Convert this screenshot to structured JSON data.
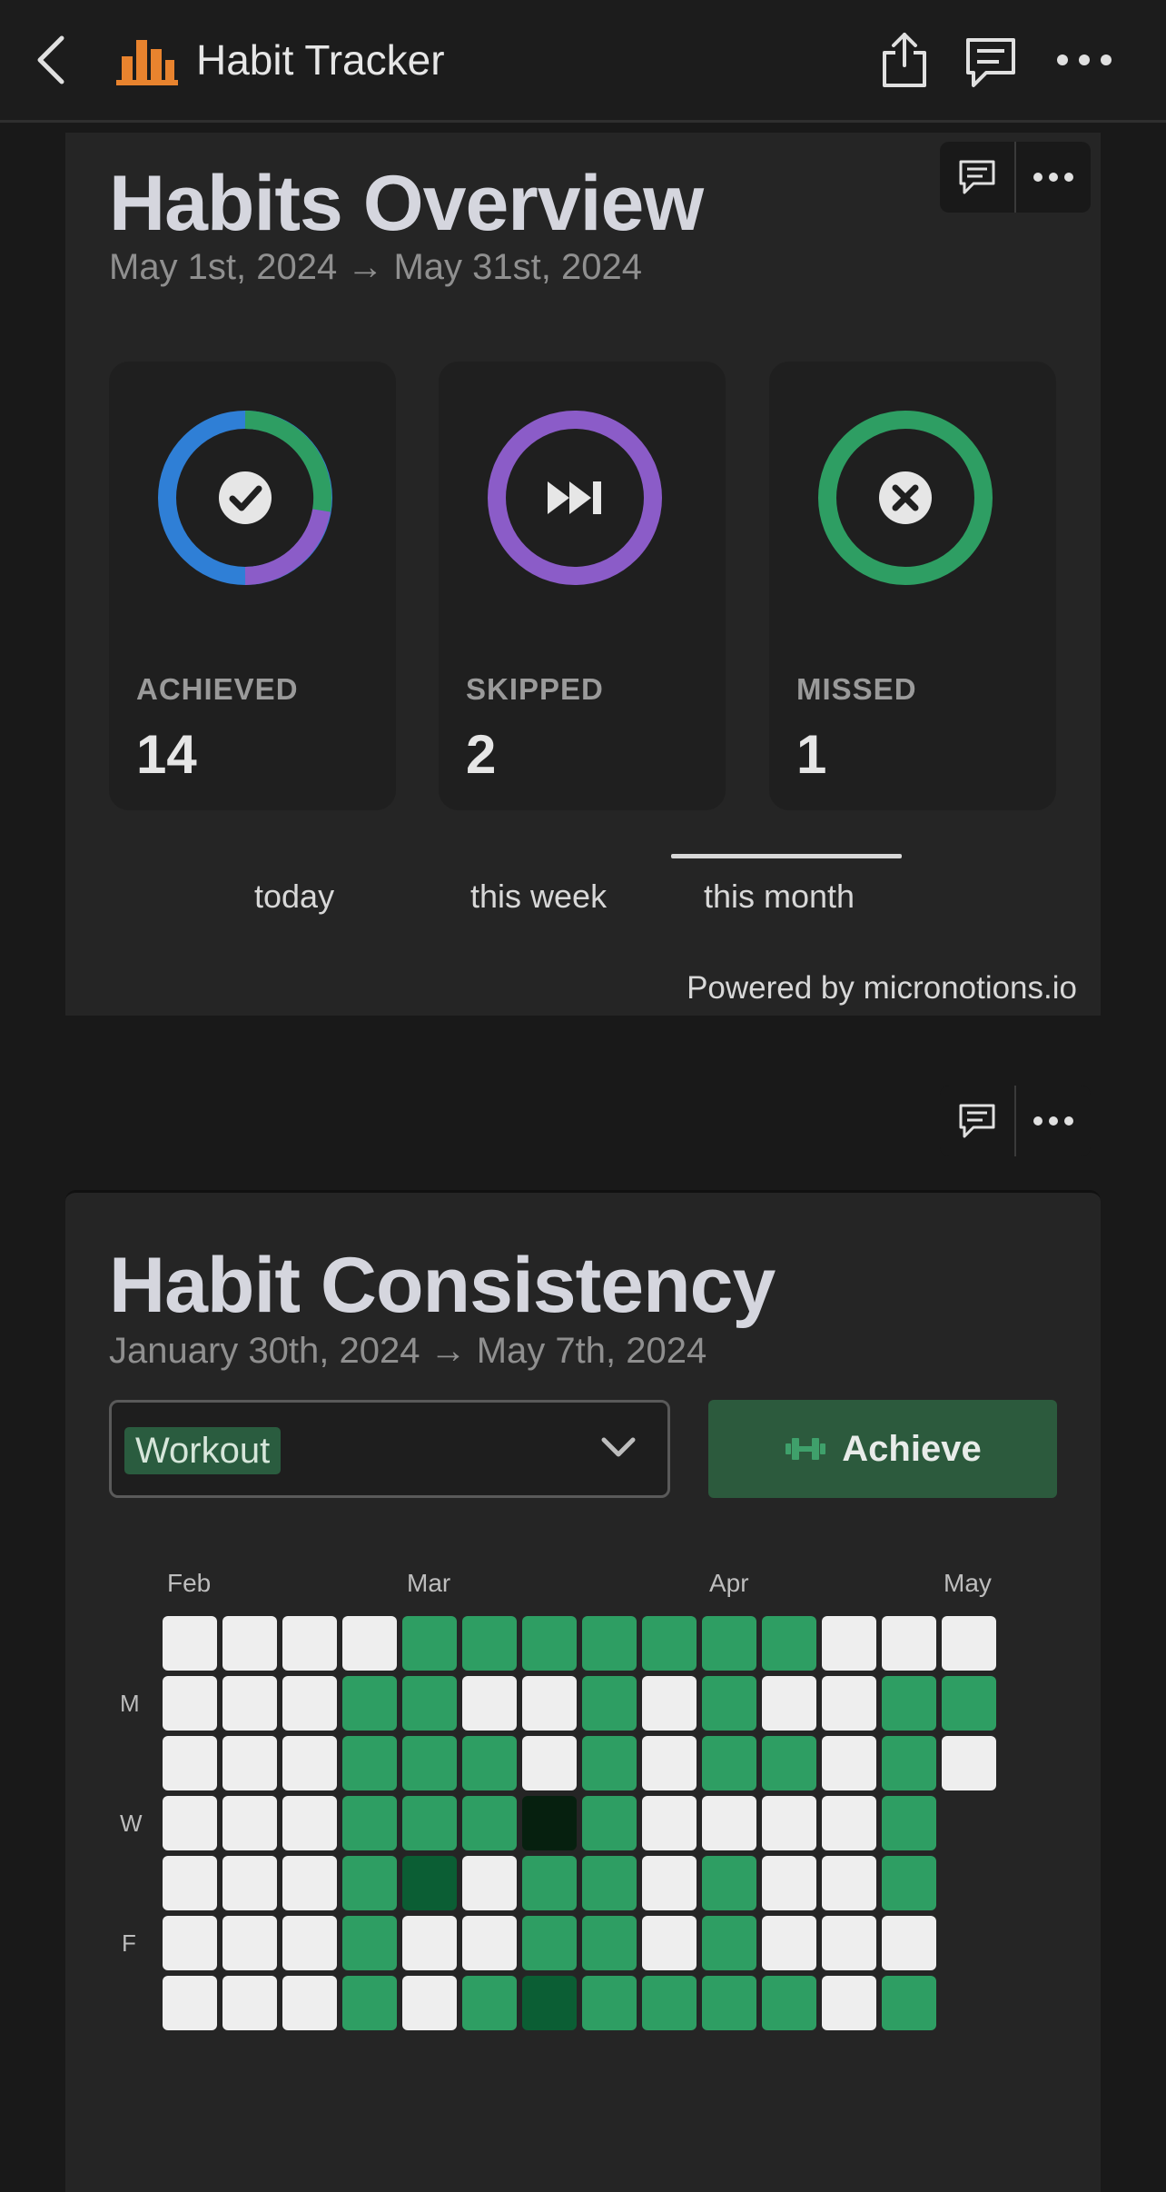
{
  "topbar": {
    "title": "Habit Tracker"
  },
  "overview": {
    "title": "Habits Overview",
    "date_range": "May 1st, 2024 → May 31st, 2024",
    "stats": [
      {
        "label": "ACHIEVED",
        "value": "14",
        "icon": "check-icon"
      },
      {
        "label": "SKIPPED",
        "value": "2",
        "icon": "skip-forward-icon"
      },
      {
        "label": "MISSED",
        "value": "1",
        "icon": "x-circle-icon"
      }
    ],
    "tabs": [
      "today",
      "this week",
      "this month"
    ],
    "active_tab": "this month",
    "powered_by": "Powered by micronotions.io"
  },
  "consistency": {
    "title": "Habit Consistency",
    "date_range": "January 30th, 2024 → May 7th, 2024",
    "habit_select": "Workout",
    "achieve_label": "Achieve",
    "months": [
      "Feb",
      "Mar",
      "Apr",
      "May"
    ],
    "day_labels": [
      "M",
      "W",
      "F"
    ],
    "heatmap": [
      [
        0,
        0,
        0,
        0,
        1,
        1,
        1,
        1,
        1,
        1,
        1,
        0,
        0,
        0
      ],
      [
        0,
        0,
        0,
        1,
        1,
        0,
        0,
        1,
        0,
        1,
        0,
        0,
        1,
        1
      ],
      [
        0,
        0,
        0,
        1,
        1,
        1,
        0,
        1,
        0,
        1,
        1,
        0,
        1,
        0
      ],
      [
        0,
        0,
        0,
        1,
        1,
        1,
        3,
        1,
        0,
        0,
        0,
        0,
        1,
        -1
      ],
      [
        0,
        0,
        0,
        1,
        2,
        0,
        1,
        1,
        0,
        1,
        0,
        0,
        1,
        -1
      ],
      [
        0,
        0,
        0,
        1,
        0,
        0,
        1,
        1,
        0,
        1,
        0,
        0,
        0,
        -1
      ],
      [
        0,
        0,
        0,
        1,
        0,
        1,
        2,
        1,
        1,
        1,
        1,
        0,
        1,
        -1
      ]
    ]
  },
  "colors": {
    "achieved_blue": "#2f7fd6",
    "achieved_green": "#2e9e63",
    "skipped_purple": "#8b5cc8",
    "missed_green": "#2e9e63",
    "cell_empty": "#eeeeee",
    "cell_done": "#2e9e63",
    "cell_dark": "#0b5e34",
    "cell_darkest": "#06200f"
  }
}
